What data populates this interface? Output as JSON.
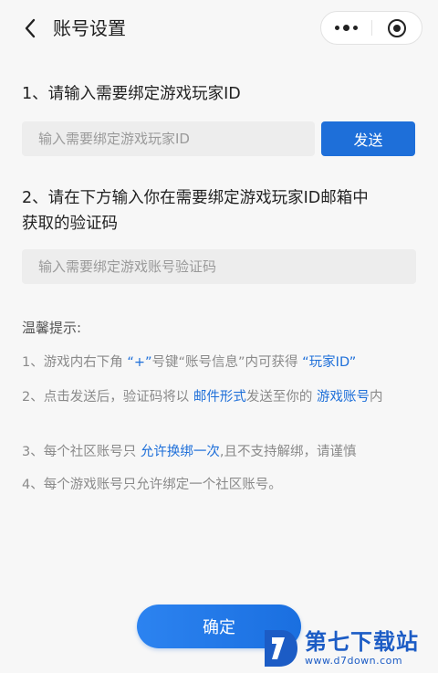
{
  "header": {
    "title": "账号设置"
  },
  "step1": {
    "title": "1、请输入需要绑定游戏玩家ID",
    "placeholder": "输入需要绑定游戏玩家ID",
    "send_label": "发送"
  },
  "step2": {
    "title_line1": "2、请在下方输入你在需要绑定游戏玩家ID邮箱中",
    "title_line2": "获取的验证码",
    "placeholder": "输入需要绑定游戏账号验证码"
  },
  "tips": {
    "title": "温馨提示:",
    "tip1": {
      "a": "1、游戏内右下角 ",
      "b": "“+”",
      "c": "号键“账号信息”内可获得 ",
      "d": "“玩家ID”"
    },
    "tip2": {
      "a": "2、点击发送后，验证码将以 ",
      "b": "邮件形式",
      "c": "发送至你的 ",
      "d": "游戏账号",
      "e": "内"
    },
    "tip3": {
      "a": "3、每个社区账号只 ",
      "b": "允许换绑一次",
      "c": ",且不支持解绑，请谨慎"
    },
    "tip4": "4、每个游戏账号只允许绑定一个社区账号。"
  },
  "confirm_label": "确定",
  "watermark": {
    "name": "第七下载站",
    "url": "www.d7down.com"
  },
  "colors": {
    "accent": "#1e6fd9",
    "input_bg": "#ededed",
    "page_bg": "#f7f7f7"
  }
}
